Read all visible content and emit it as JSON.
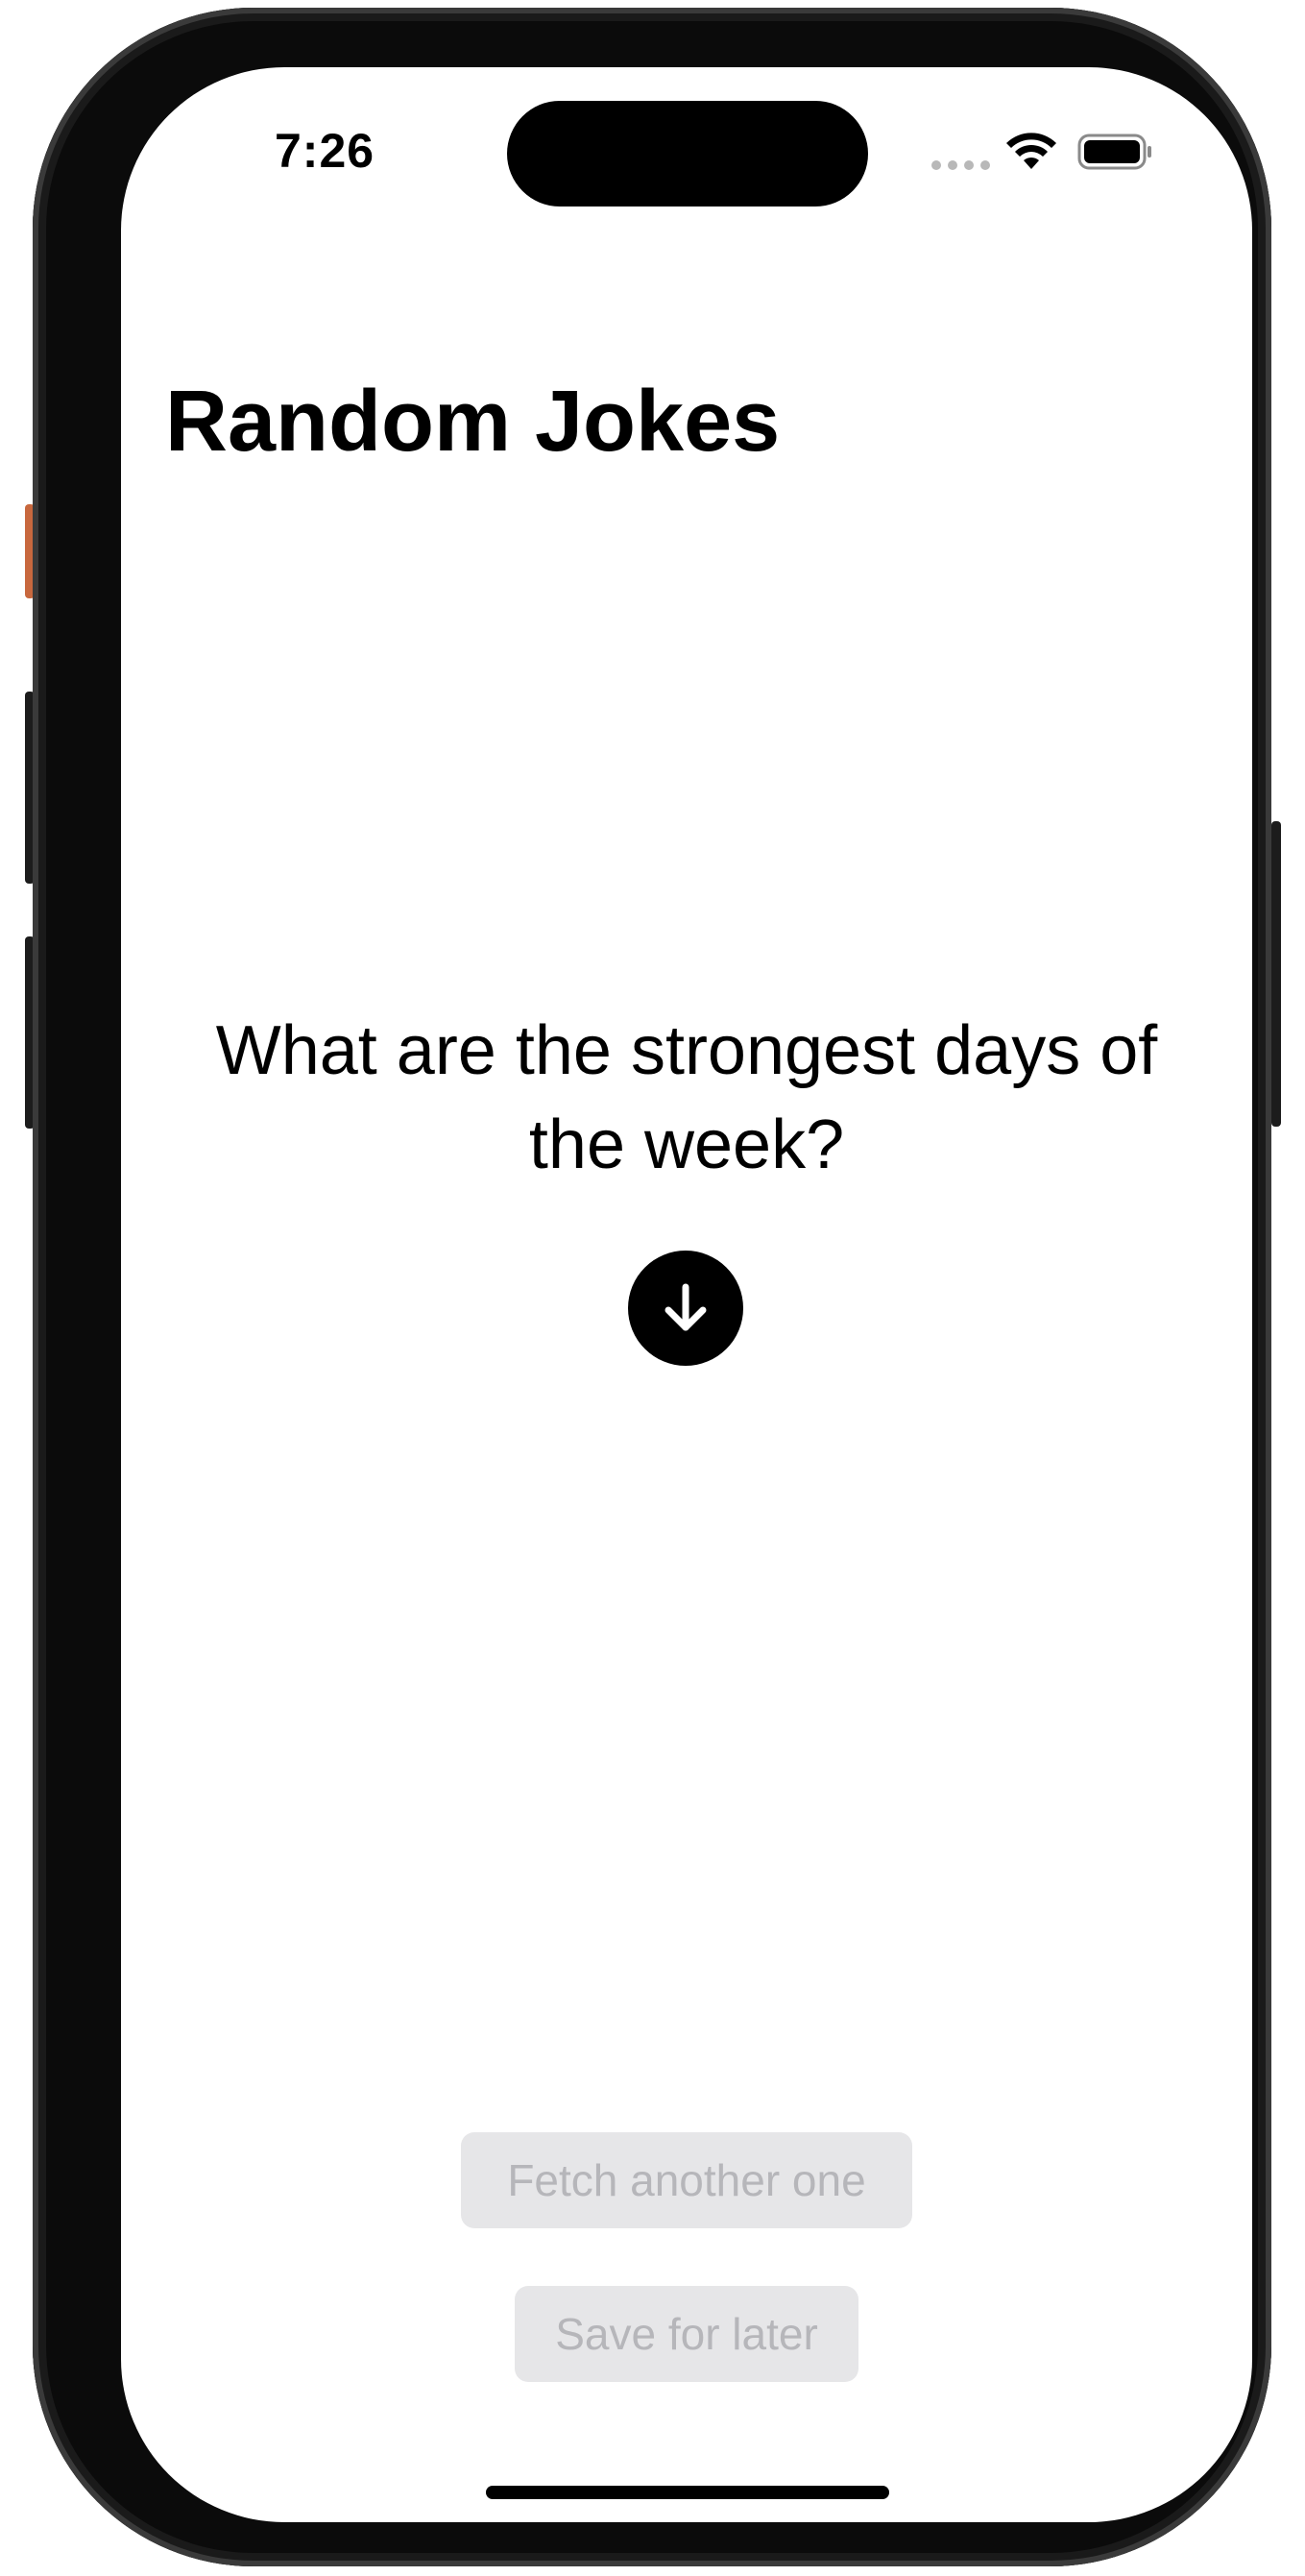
{
  "status_bar": {
    "time": "7:26",
    "icons": [
      "cellular-signal-icon",
      "wifi-icon",
      "battery-icon"
    ]
  },
  "nav": {
    "title": "Random Jokes"
  },
  "joke": {
    "setup": "What are the strongest days of the week?"
  },
  "reveal_button": {
    "icon": "arrow-down-circle-icon"
  },
  "actions": {
    "fetch_label": "Fetch another one",
    "save_label": "Save for later"
  },
  "colors": {
    "accent": "#000000",
    "disabled_bg": "#e6e6e8",
    "disabled_text": "#b6b6ba",
    "background": "#ffffff"
  }
}
